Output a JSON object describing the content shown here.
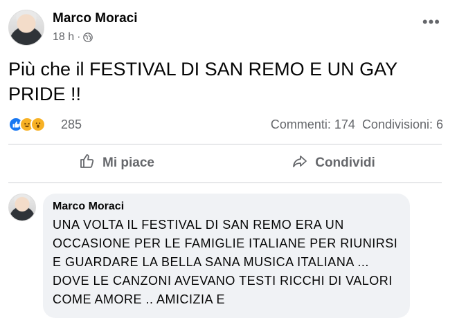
{
  "post": {
    "author": "Marco Moraci",
    "time": "18 h",
    "separator": "·",
    "privacy_icon": "globe-icon",
    "more_icon": "more-options-icon",
    "text": "Più che il FESTIVAL DI SAN REMO E UN GAY PRIDE !!"
  },
  "reactions": {
    "icons": [
      "like-icon",
      "haha-icon",
      "wow-icon"
    ],
    "count": "285",
    "comments": "Commenti: 174",
    "shares": "Condivisioni: 6"
  },
  "actions": {
    "like_label": "Mi piace",
    "share_label": "Condividi"
  },
  "comment": {
    "author": "Marco Moraci",
    "text": "UNA VOLTA IL FESTIVAL DI SAN REMO ERA UN OCCASIONE PER LE FAMIGLIE ITALIANE PER RIUNIRSI E GUARDARE LA BELLA SANA MUSICA ITALIANA ... DOVE LE CANZONI AVEVANO TESTI RICCHI DI VALORI COME AMORE .. AMICIZIA E"
  },
  "colors": {
    "accent": "#1877f2",
    "secondary_text": "#65676b",
    "bubble": "#f0f2f5"
  }
}
